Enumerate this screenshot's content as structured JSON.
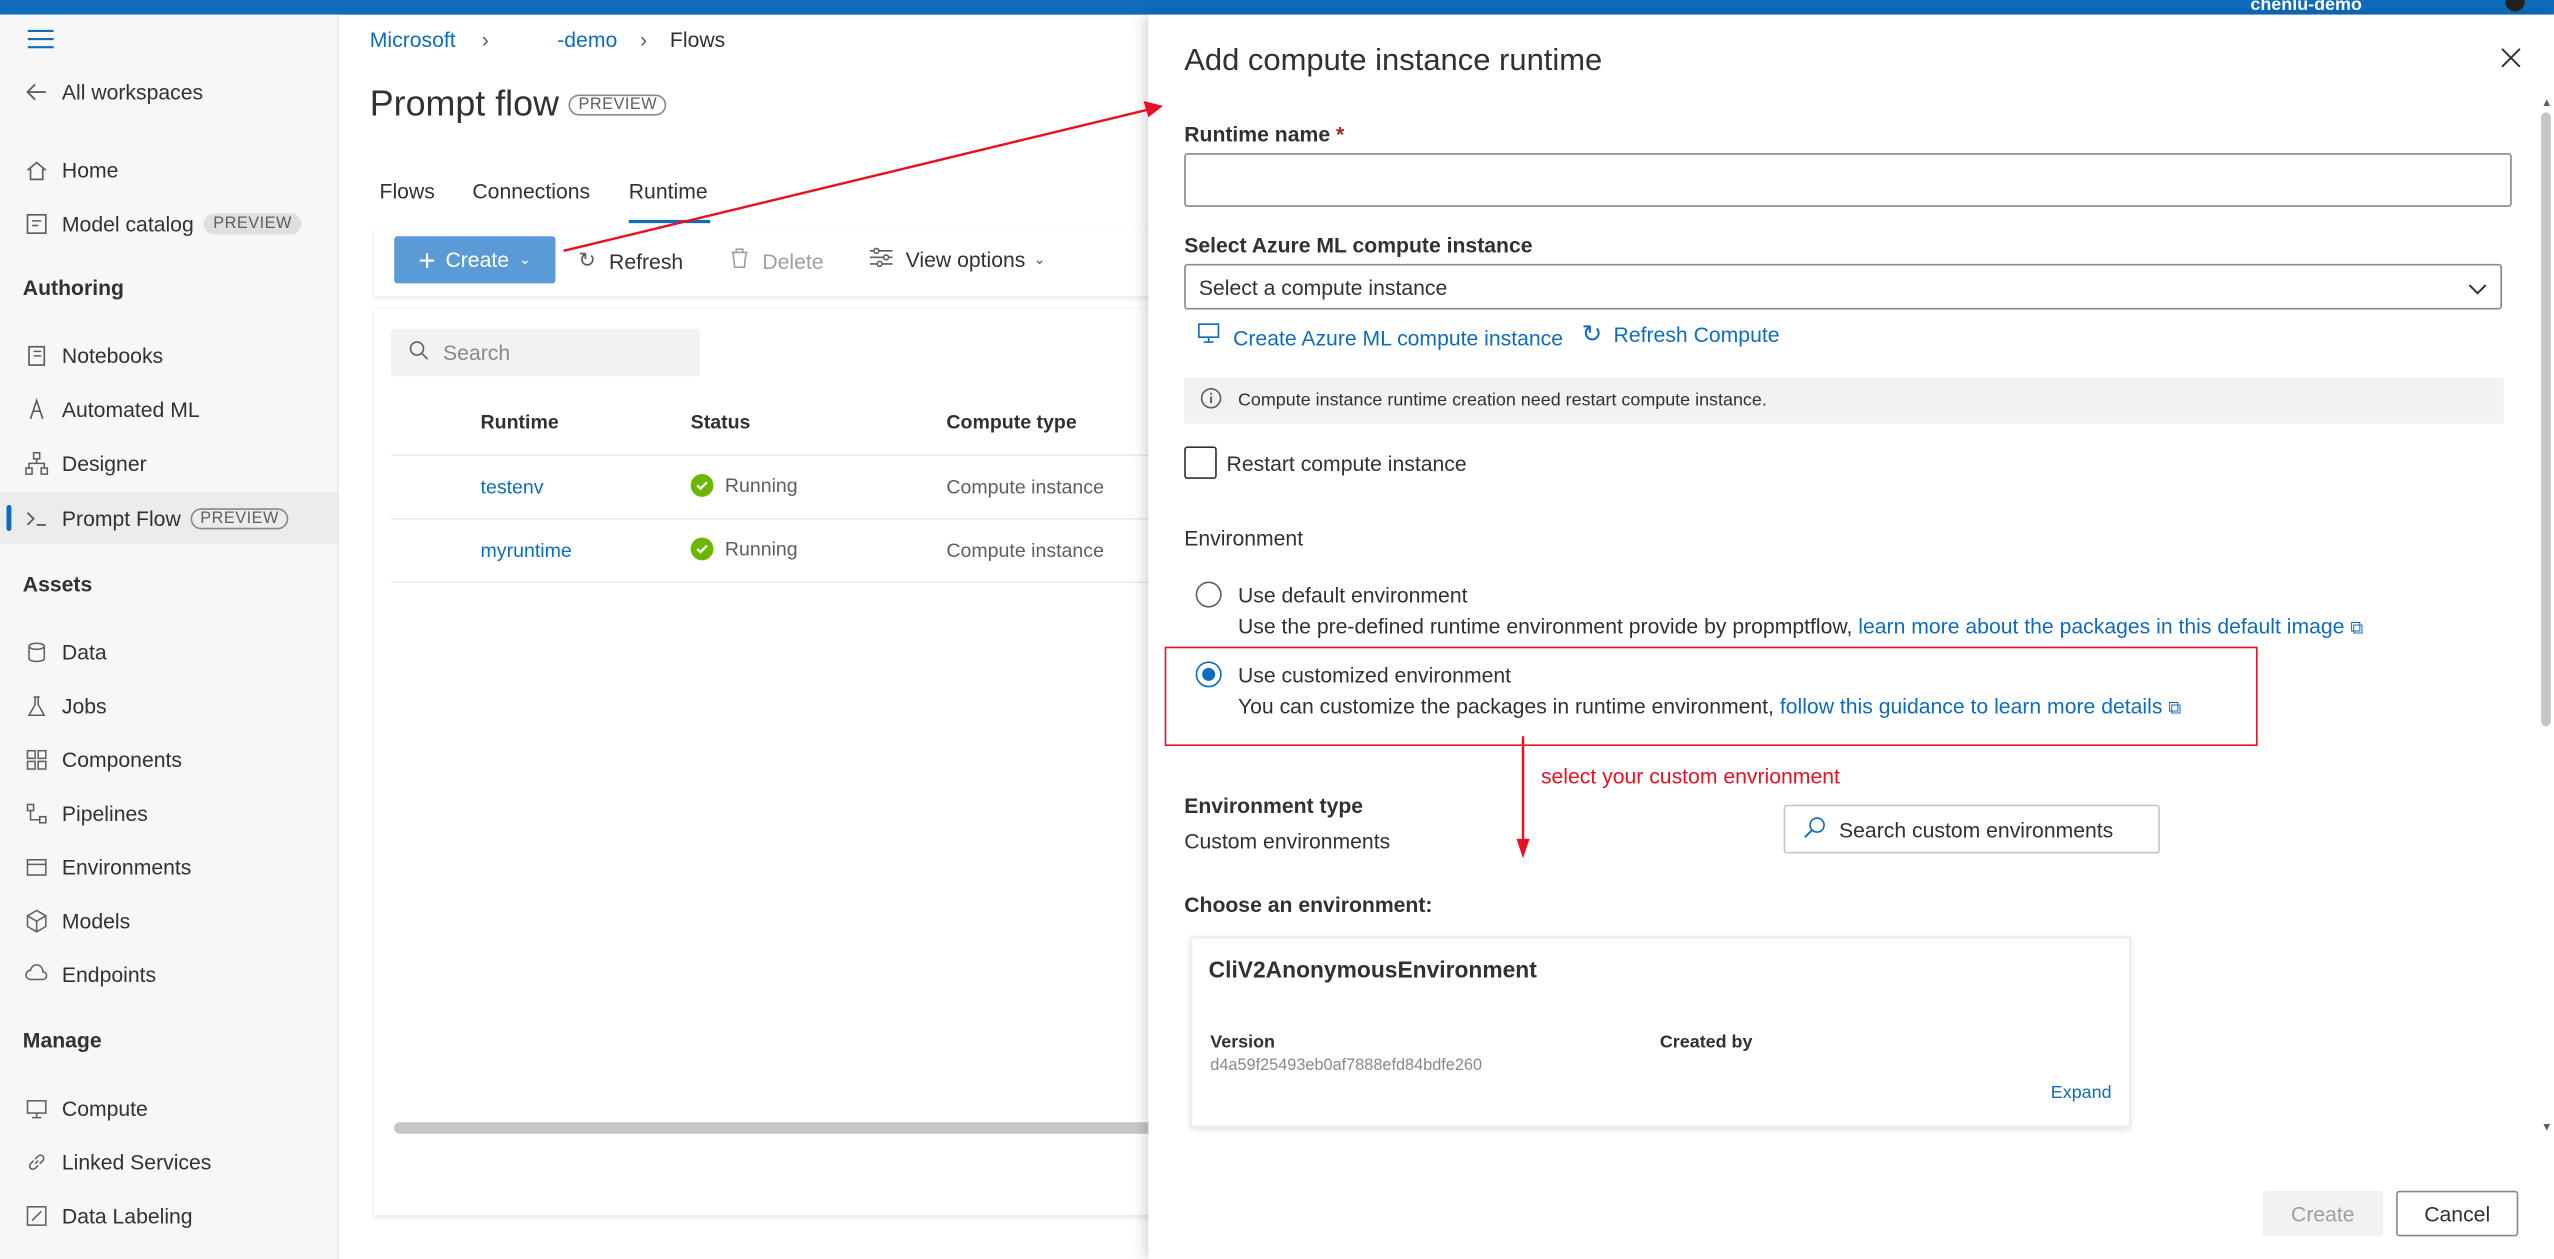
{
  "top_bar": {
    "user": "chenlu-demo"
  },
  "left_nav": {
    "all_workspaces": "All workspaces",
    "items_top": [
      {
        "label": "Home",
        "icon": "home-icon"
      },
      {
        "label": "Model catalog",
        "badge": "PREVIEW",
        "icon": "catalog-icon"
      }
    ],
    "authoring": {
      "title": "Authoring",
      "items": [
        {
          "label": "Notebooks",
          "icon": "notebook-icon"
        },
        {
          "label": "Automated ML",
          "icon": "automl-icon"
        },
        {
          "label": "Designer",
          "icon": "designer-icon"
        },
        {
          "label": "Prompt Flow",
          "badge": "PREVIEW",
          "icon": "prompt-icon",
          "selected": true
        }
      ]
    },
    "assets": {
      "title": "Assets",
      "items": [
        {
          "label": "Data",
          "icon": "data-icon"
        },
        {
          "label": "Jobs",
          "icon": "jobs-icon"
        },
        {
          "label": "Components",
          "icon": "components-icon"
        },
        {
          "label": "Pipelines",
          "icon": "pipelines-icon"
        },
        {
          "label": "Environments",
          "icon": "environments-icon"
        },
        {
          "label": "Models",
          "icon": "models-icon"
        },
        {
          "label": "Endpoints",
          "icon": "endpoints-icon"
        }
      ]
    },
    "manage": {
      "title": "Manage",
      "items": [
        {
          "label": "Compute",
          "icon": "compute-icon"
        },
        {
          "label": "Linked Services",
          "icon": "link-icon"
        },
        {
          "label": "Data Labeling",
          "icon": "labeling-icon"
        }
      ]
    }
  },
  "breadcrumb": {
    "root": "Microsoft",
    "workspace": "-demo",
    "current": "Flows"
  },
  "main": {
    "title": "Prompt flow",
    "title_badge": "PREVIEW",
    "tabs": [
      "Flows",
      "Connections",
      "Runtime"
    ],
    "active_tab": "Runtime",
    "commands": {
      "create": "Create",
      "refresh": "Refresh",
      "delete": "Delete",
      "view_options": "View options"
    },
    "search_placeholder": "Search",
    "table": {
      "headers": [
        "Runtime",
        "Status",
        "Compute type"
      ],
      "rows": [
        {
          "runtime": "testenv",
          "status": "Running",
          "compute_type": "Compute instance"
        },
        {
          "runtime": "myruntime",
          "status": "Running",
          "compute_type": "Compute instance"
        }
      ]
    }
  },
  "panel": {
    "title": "Add compute instance runtime",
    "runtime_name_label": "Runtime name",
    "required_mark": "*",
    "runtime_name_value": "",
    "compute_label": "Select Azure ML compute instance",
    "compute_placeholder": "Select a compute instance",
    "create_compute_link": "Create Azure ML compute instance",
    "refresh_compute_link": "Refresh Compute",
    "info_text": "Compute instance runtime creation need restart compute instance.",
    "restart_label": "Restart compute instance",
    "environment_heading": "Environment",
    "default_env": {
      "title": "Use default environment",
      "desc": "Use the pre-defined runtime environment provide by propmptflow,",
      "link": "learn more about the packages in this default image"
    },
    "custom_env": {
      "title": "Use customized environment",
      "desc": "You can customize the packages in runtime environment,",
      "link": "follow this guidance to learn more details"
    },
    "annotation": "select your custom envrionment",
    "env_type_label": "Environment type",
    "env_type_value": "Custom environments",
    "env_search_placeholder": "Search custom environments",
    "choose_label": "Choose an environment:",
    "card": {
      "name": "CliV2AnonymousEnvironment",
      "version_label": "Version",
      "version_value": "d4a59f25493eb0af7888efd84bdfe260",
      "created_by_label": "Created by",
      "expand": "Expand"
    },
    "create_button": "Create",
    "cancel_button": "Cancel"
  },
  "colors": {
    "accent": "#0f6cbd",
    "annotation_red": "#e81123",
    "running_green": "#6bb700"
  }
}
